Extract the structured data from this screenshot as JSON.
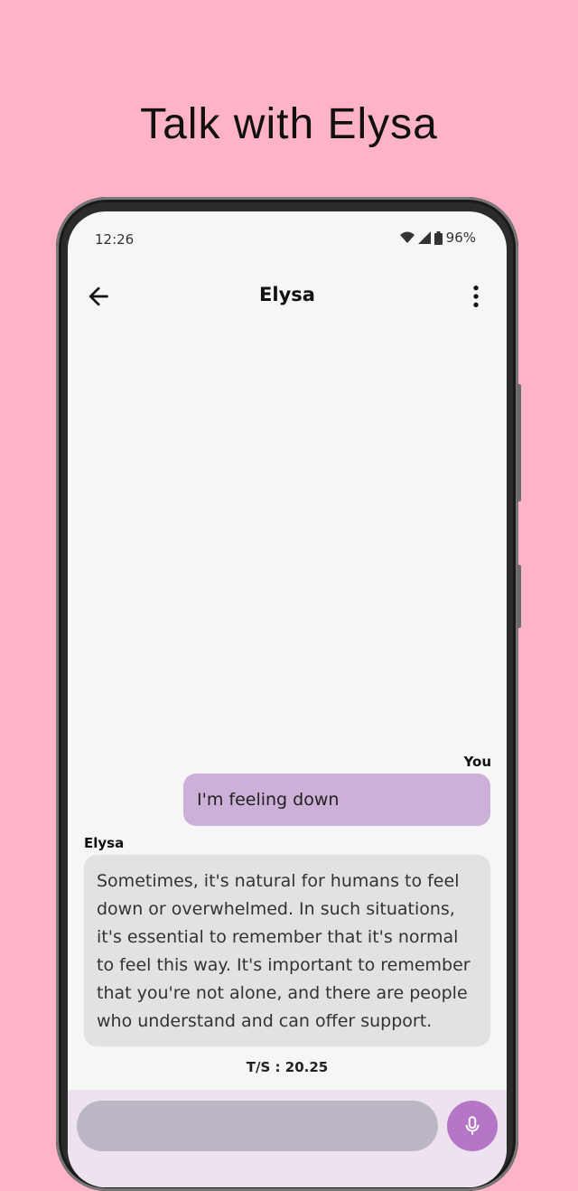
{
  "promo": {
    "headline": "Talk with Elysa"
  },
  "status_bar": {
    "time": "12:26",
    "battery": "96%"
  },
  "app_bar": {
    "title": "Elysa"
  },
  "conversation": {
    "user_message": {
      "sender": "You",
      "text": "I'm feeling down"
    },
    "bot_message": {
      "sender": "Elysa",
      "text": "Sometimes, it's natural for humans to feel down or overwhelmed. In such situations, it's essential to remember that it's normal to feel this way. It's important to remember that you're not alone, and there are people who understand and can offer support."
    },
    "stat": "T/S : 20.25"
  },
  "composer": {
    "placeholder": ""
  },
  "colors": {
    "background": "#ffb3c7",
    "user_bubble": "#cdb0d8",
    "bot_bubble": "#e2e2e2",
    "mic_button": "#b576c7"
  },
  "icons": [
    "back-arrow-icon",
    "more-vert-icon",
    "wifi-icon",
    "signal-icon",
    "battery-icon",
    "mic-icon"
  ]
}
